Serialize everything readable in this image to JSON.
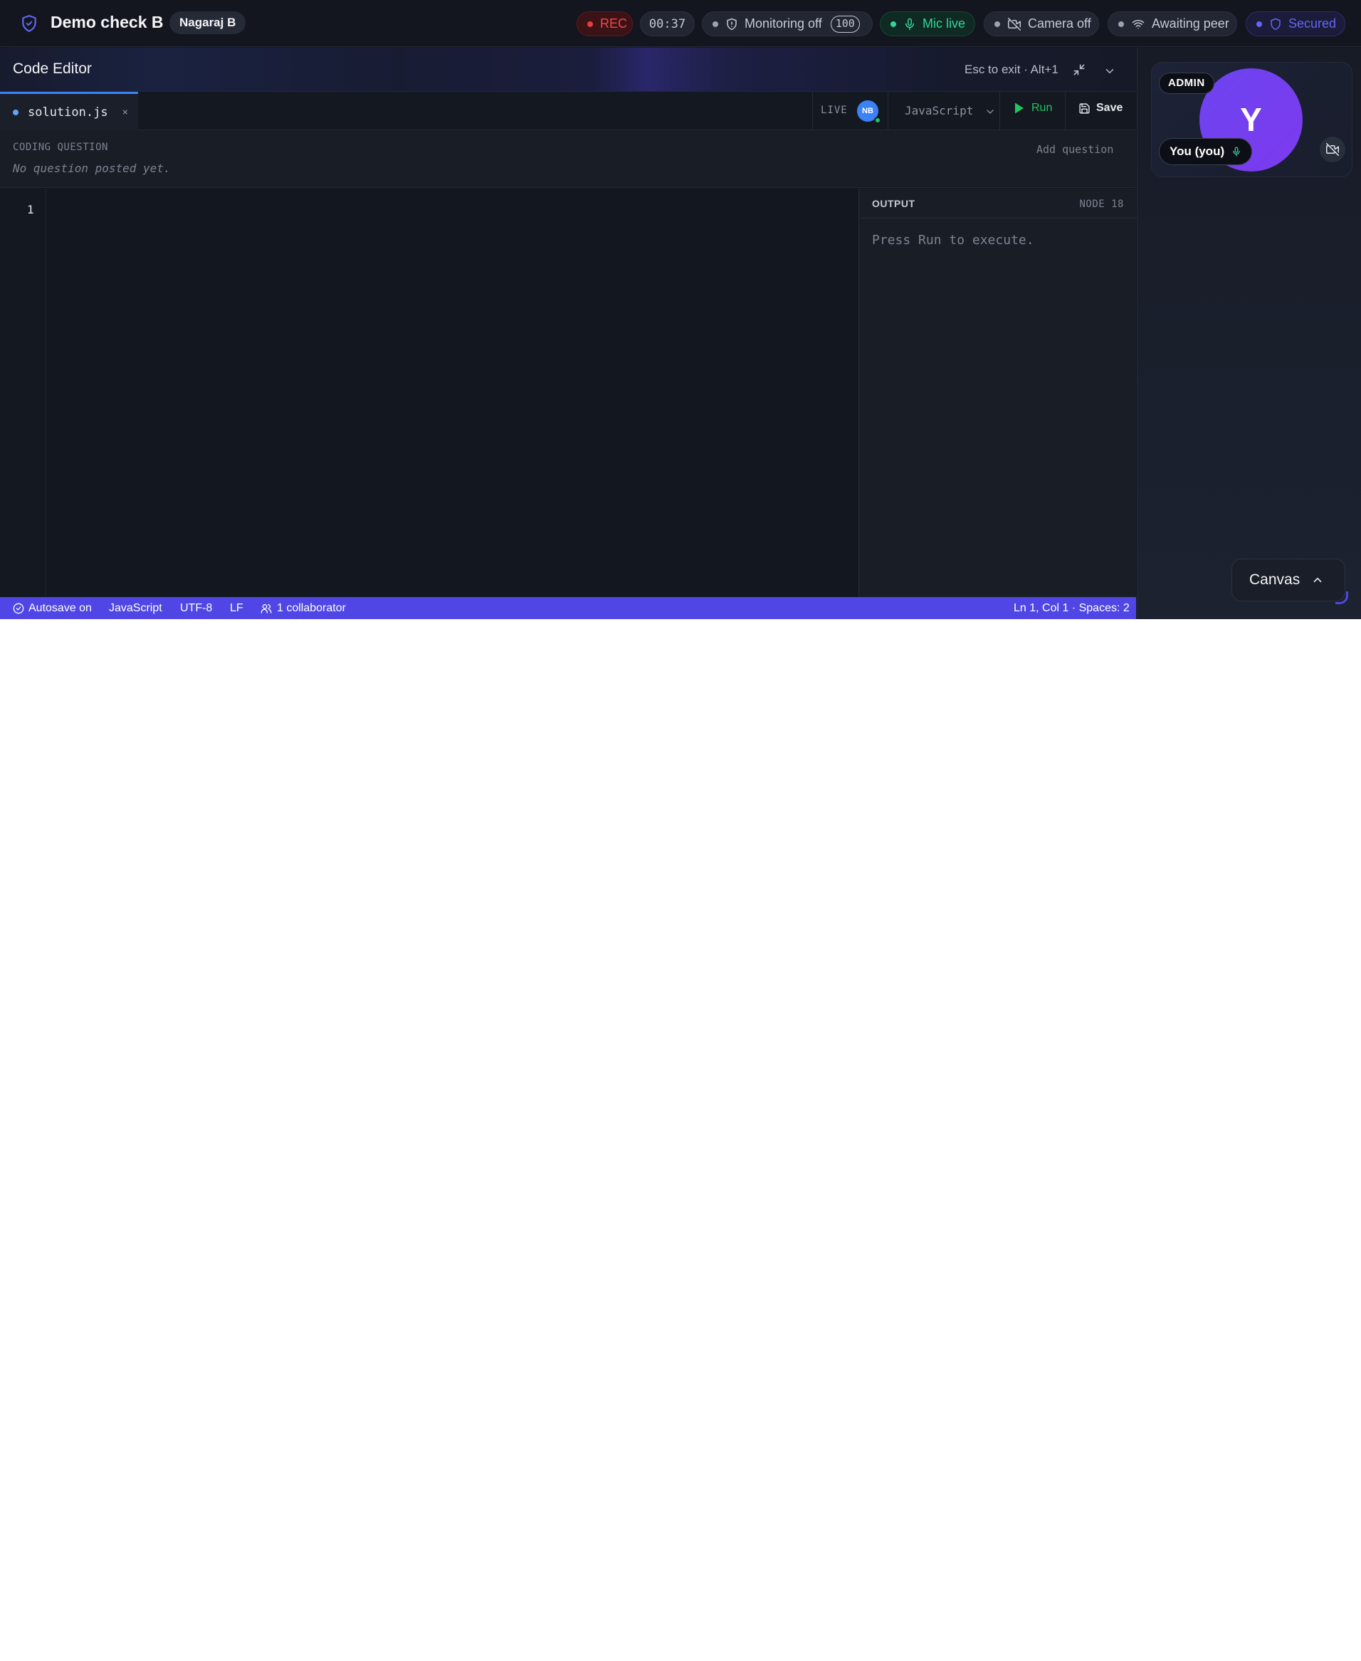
{
  "topbar": {
    "title": "Demo check B",
    "user": "Nagaraj B",
    "rec_label": "REC",
    "timer": "00:37",
    "monitoring_label": "Monitoring off",
    "monitoring_count": "100",
    "mic_label": "Mic live",
    "camera_label": "Camera off",
    "peer_label": "Awaiting peer",
    "secured_label": "Secured"
  },
  "editor": {
    "title": "Code Editor",
    "exit_hint": "Esc to exit · Alt+1",
    "tab": {
      "filename": "solution.js",
      "close": "×"
    },
    "live_label": "LIVE",
    "collaborator_initials": "NB",
    "language": "JavaScript",
    "run_label": "Run",
    "save_label": "Save",
    "question": {
      "label": "CODING QUESTION",
      "text": "No question posted yet.",
      "add_label": "Add question"
    },
    "line_numbers": [
      "1"
    ],
    "output": {
      "label": "OUTPUT",
      "runtime": "NODE 18",
      "placeholder": "Press Run to execute."
    }
  },
  "statusbar": {
    "autosave": "Autosave on",
    "language": "JavaScript",
    "encoding": "UTF-8",
    "line_ending": "LF",
    "collaborators": "1 collaborator",
    "cursor": "Ln 1, Col 1 · Spaces: 2"
  },
  "sidebar": {
    "admin_badge": "ADMIN",
    "avatar_initial": "Y",
    "participant_label": "You (you)",
    "canvas_label": "Canvas"
  },
  "colors": {
    "accent": "#4f46e5",
    "rec": "#f04848",
    "mic_live": "#34d399",
    "run": "#22c55e",
    "secured": "#6366f1"
  }
}
